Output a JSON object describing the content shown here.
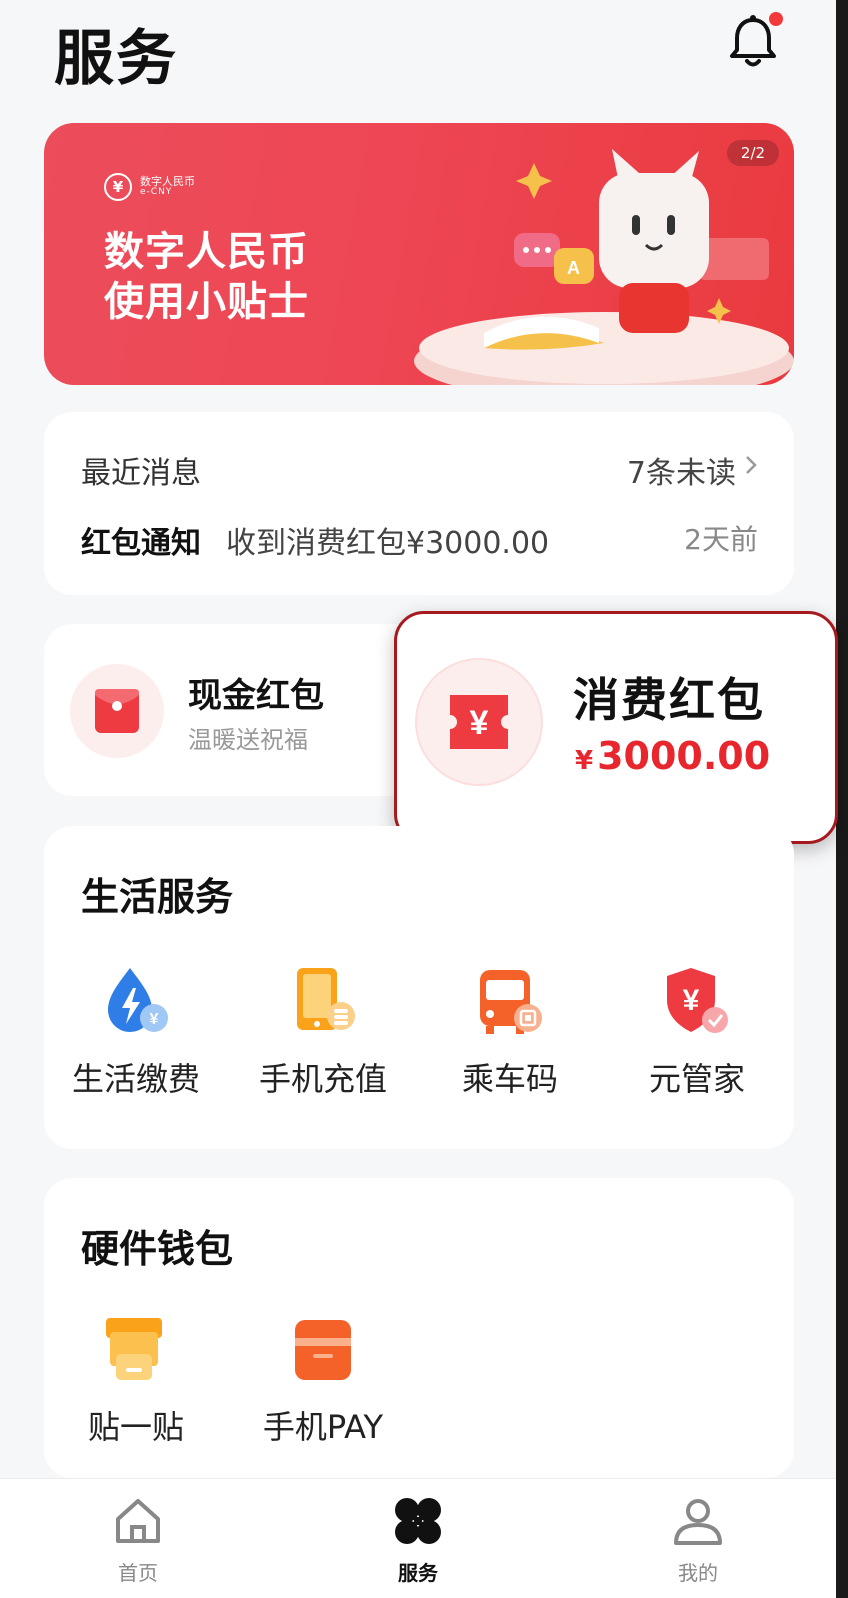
{
  "header": {
    "title": "服务"
  },
  "banner": {
    "logo_cn": "数字人民币",
    "logo_en": "e-CNY",
    "title_line1": "数字人民币",
    "title_line2": "使用小贴士",
    "page_indicator": "2/2"
  },
  "messages": {
    "header": "最近消息",
    "unread": "7条未读",
    "tag": "红包通知",
    "text": "收到消费红包¥3000.00",
    "time": "2天前"
  },
  "red_packets": {
    "cash": {
      "name": "现金红包",
      "subtitle": "温暖送祝福"
    },
    "consumption": {
      "name": "消费红包",
      "currency": "¥",
      "amount": "3000.00"
    }
  },
  "life_services": {
    "title": "生活服务",
    "items": [
      {
        "label": "生活缴费",
        "icon": "utility-bill-icon"
      },
      {
        "label": "手机充值",
        "icon": "phone-topup-icon"
      },
      {
        "label": "乘车码",
        "icon": "bus-code-icon"
      },
      {
        "label": "元管家",
        "icon": "yuan-manager-icon"
      }
    ]
  },
  "hardware_wallet": {
    "title": "硬件钱包",
    "items": [
      {
        "label": "贴一贴",
        "icon": "tap-card-icon"
      },
      {
        "label": "手机PAY",
        "icon": "phone-pay-icon"
      }
    ]
  },
  "tabbar": {
    "items": [
      {
        "label": "首页",
        "icon": "home-icon"
      },
      {
        "label": "服务",
        "icon": "services-icon",
        "active": true
      },
      {
        "label": "我的",
        "icon": "profile-icon"
      }
    ]
  },
  "colors": {
    "accent": "#e8262d",
    "banner": "#ec4d5b",
    "background": "#f6f7f9"
  }
}
